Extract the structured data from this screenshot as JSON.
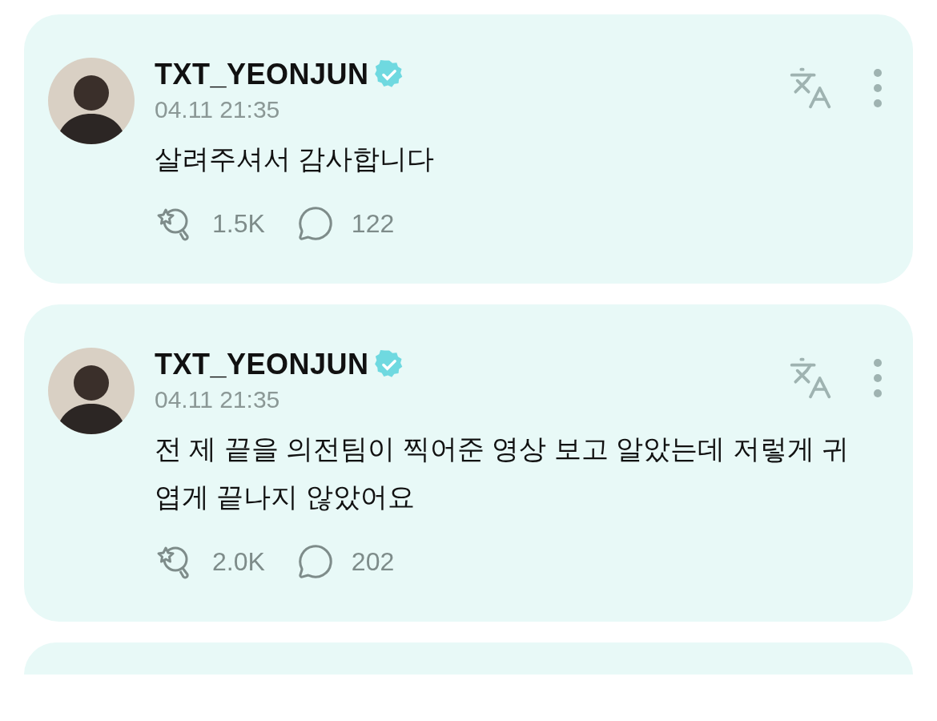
{
  "posts": [
    {
      "author": "TXT_YEONJUN",
      "verified": true,
      "time": "04.11 21:35",
      "text": "살려주셔서 감사합니다",
      "reactions": "1.5K",
      "comments": "122"
    },
    {
      "author": "TXT_YEONJUN",
      "verified": true,
      "time": "04.11 21:35",
      "text": "전 제 끝을 의전팀이 찍어준 영상 보고 알았는데 저렇게 귀엽게 끝나지 않았어요",
      "reactions": "2.0K",
      "comments": "202"
    }
  ]
}
